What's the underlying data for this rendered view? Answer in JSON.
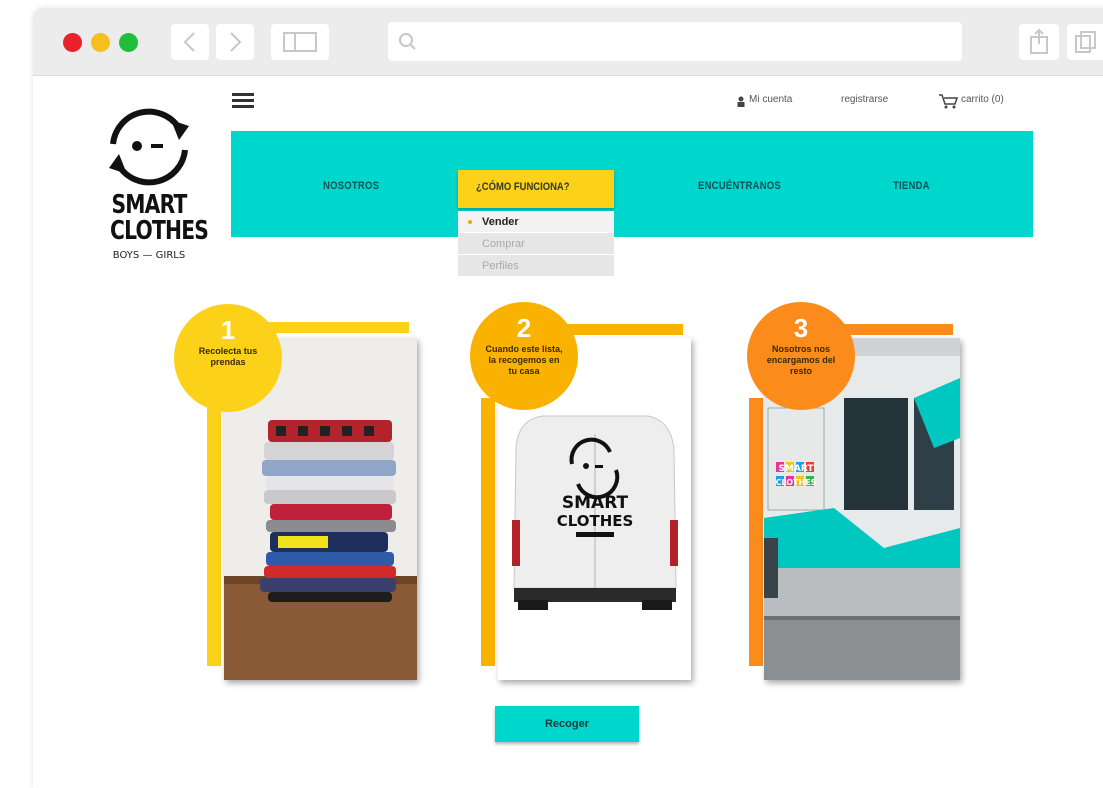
{
  "header": {
    "my_account": "Mi cuenta",
    "register": "registrarse",
    "cart": "carrito (0)"
  },
  "logo": {
    "line1": "SMART",
    "line2": "CLOTHES",
    "tagline": "BOYS — GIRLS"
  },
  "nav": {
    "items": [
      {
        "label": "NOSOTROS"
      },
      {
        "label": "¿CÓMO FUNCIONA?"
      },
      {
        "label": "ENCUÉNTRANOS"
      },
      {
        "label": "TIENDA"
      }
    ],
    "dropdown": [
      "Vender",
      "Comprar",
      "Perfiles"
    ]
  },
  "steps": [
    {
      "number": "1",
      "text": "Recolecta tus prendas"
    },
    {
      "number": "2",
      "text": "Cuando este lista, la recogemos en tu casa"
    },
    {
      "number": "3",
      "text": "Nosotros nos encargamos del resto"
    }
  ],
  "van_logo": {
    "line1": "SMART",
    "line2": "CLOTHES"
  },
  "store_sign": {
    "line1": "SMART",
    "line2": "CLOTHES"
  },
  "cta": {
    "label": "Recoger"
  },
  "colors": {
    "accent": "#00d7cc",
    "yellow": "#fbd219",
    "amber": "#f9b200",
    "orange": "#fb8c1c"
  }
}
